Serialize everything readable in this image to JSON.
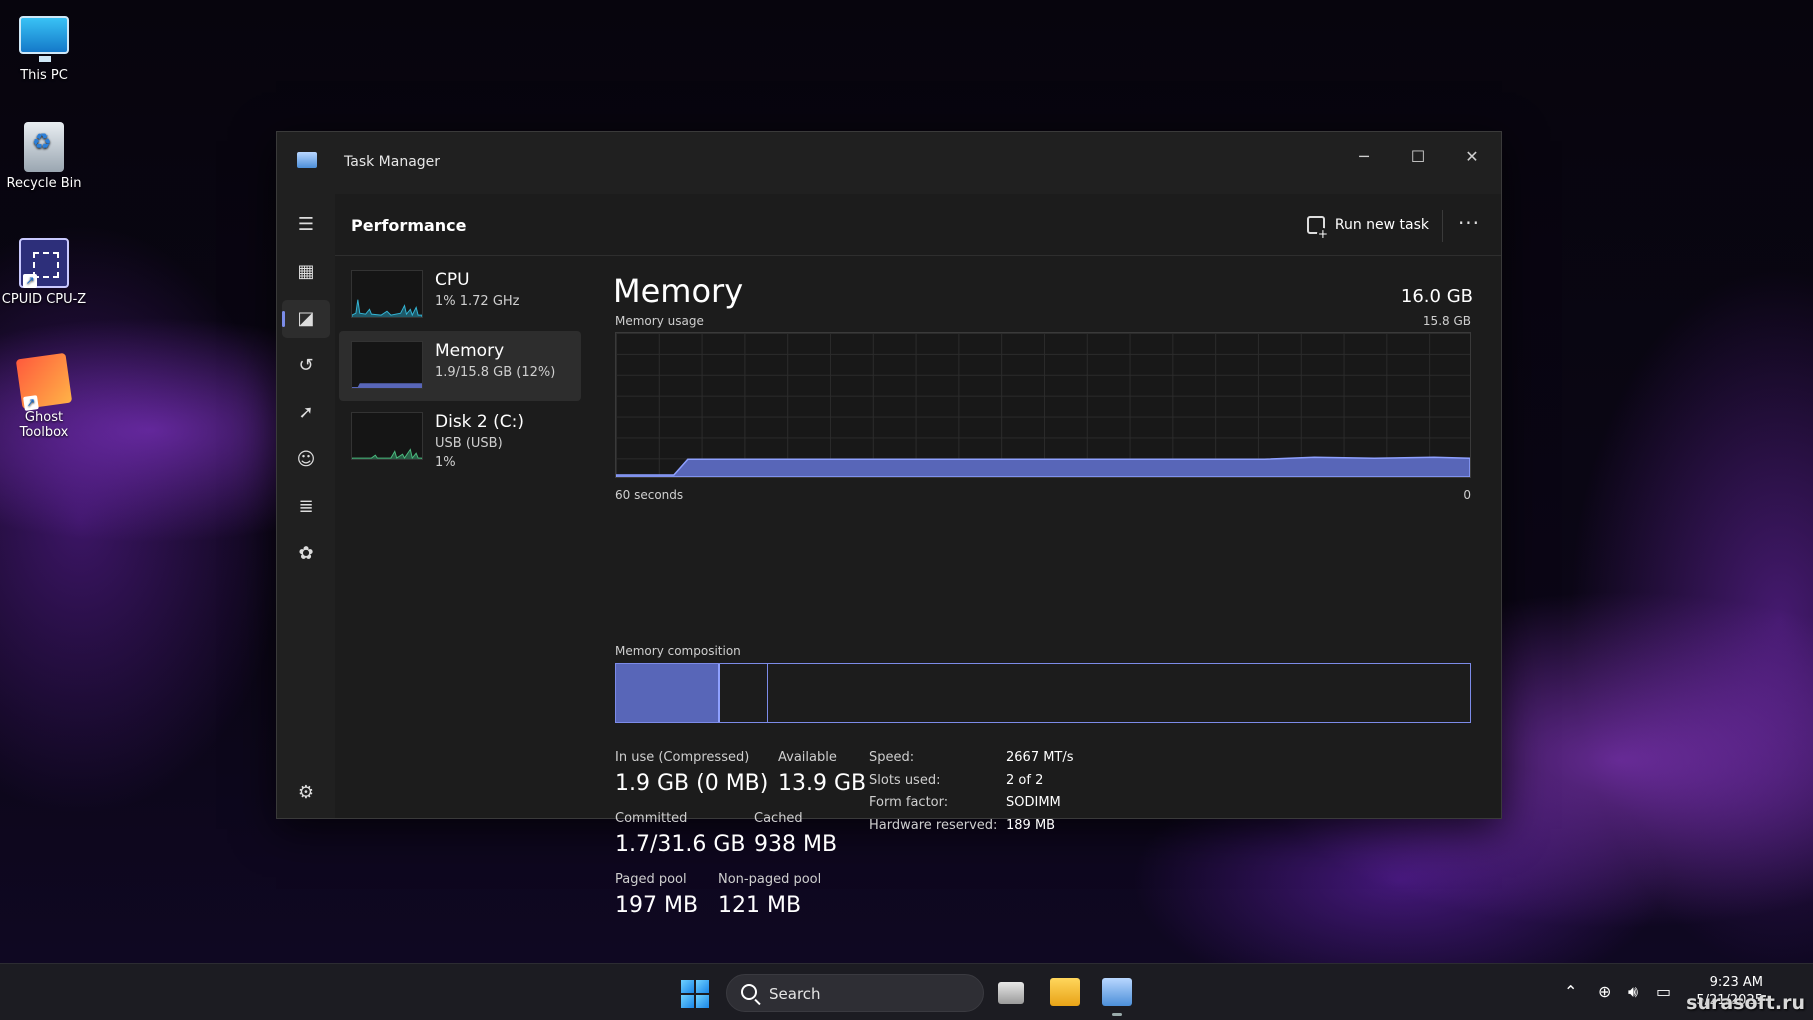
{
  "desktop": {
    "icons": [
      {
        "label": "This PC"
      },
      {
        "label": "Recycle Bin"
      },
      {
        "label": "CPUID CPU-Z"
      },
      {
        "label": "Ghost Toolbox"
      }
    ]
  },
  "window": {
    "title": "Task Manager",
    "controls": {
      "minimize": "─",
      "maximize": "☐",
      "close": "✕"
    }
  },
  "header": {
    "page_title": "Performance",
    "run_new_task": "Run new task",
    "more": "···"
  },
  "devices": [
    {
      "name": "CPU",
      "sub": "1% 1.72 GHz",
      "sub2": ""
    },
    {
      "name": "Memory",
      "sub": "1.9/15.8 GB (12%)",
      "sub2": ""
    },
    {
      "name": "Disk 2 (C:)",
      "sub": "USB (USB)",
      "sub2": "1%"
    }
  ],
  "memory": {
    "title": "Memory",
    "total": "16.0 GB",
    "usage_label": "Memory usage",
    "usage_max": "15.8 GB",
    "time_left": "60 seconds",
    "time_right": "0",
    "composition_label": "Memory composition",
    "composition": {
      "in_use_fraction": 0.122,
      "modified_fraction": 0.178
    },
    "stats": {
      "in_use": {
        "label": "In use (Compressed)",
        "value": "1.9 GB (0 MB)"
      },
      "available": {
        "label": "Available",
        "value": "13.9 GB"
      },
      "committed": {
        "label": "Committed",
        "value": "1.7/31.6 GB"
      },
      "cached": {
        "label": "Cached",
        "value": "938 MB"
      },
      "paged_pool": {
        "label": "Paged pool",
        "value": "197 MB"
      },
      "nonpaged_pool": {
        "label": "Non-paged pool",
        "value": "121 MB"
      }
    },
    "specs": [
      {
        "label": "Speed:",
        "value": "2667 MT/s"
      },
      {
        "label": "Slots used:",
        "value": "2 of 2"
      },
      {
        "label": "Form factor:",
        "value": "SODIMM"
      },
      {
        "label": "Hardware reserved:",
        "value": "189 MB"
      }
    ],
    "accent": "#7c8be8"
  },
  "taskbar": {
    "search_label": "Search",
    "time": "9:23 AM",
    "date": "5/21/2025"
  },
  "watermark": "surasoft.ru"
}
